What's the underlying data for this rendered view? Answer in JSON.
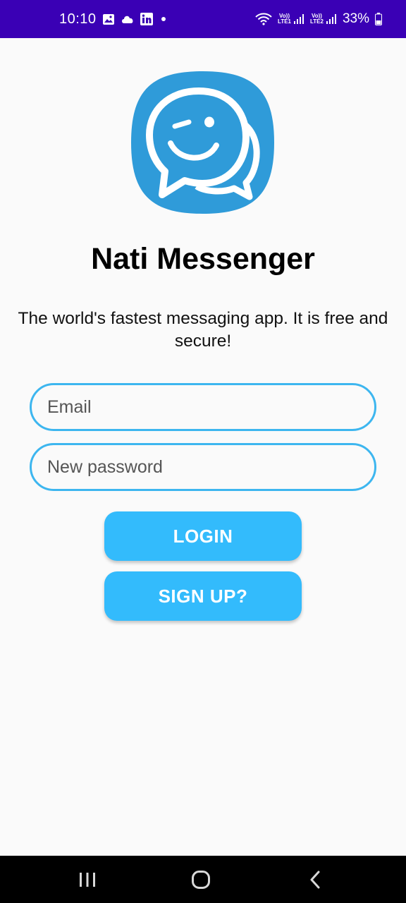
{
  "status_bar": {
    "time": "10:10",
    "battery_percent": "33%",
    "sim1_label": "LTE1",
    "sim2_label": "LTE2",
    "volte_label": "Vo))",
    "icons": [
      "image-icon",
      "cloud-icon",
      "linkedin-icon",
      "notification-dot-icon",
      "wifi-icon",
      "signal-sim1-icon",
      "signal-sim2-icon",
      "battery-icon"
    ]
  },
  "app": {
    "title": "Nati Messenger",
    "tagline": "The world's fastest messaging app. It is free and secure!",
    "logo_icon": "chat-bubble-wink-icon"
  },
  "form": {
    "email_placeholder": "Email",
    "password_placeholder": "New password"
  },
  "buttons": {
    "login": "LOGIN",
    "signup": "SIGN UP?"
  },
  "nav_bar": {
    "icons": [
      "recents-icon",
      "home-icon",
      "back-icon"
    ]
  },
  "colors": {
    "status_bar_bg": "#3a00b5",
    "accent": "#33bbfc",
    "field_border": "#3db6ef",
    "logo_bg": "#2f9bd9",
    "background": "#fafafa"
  }
}
